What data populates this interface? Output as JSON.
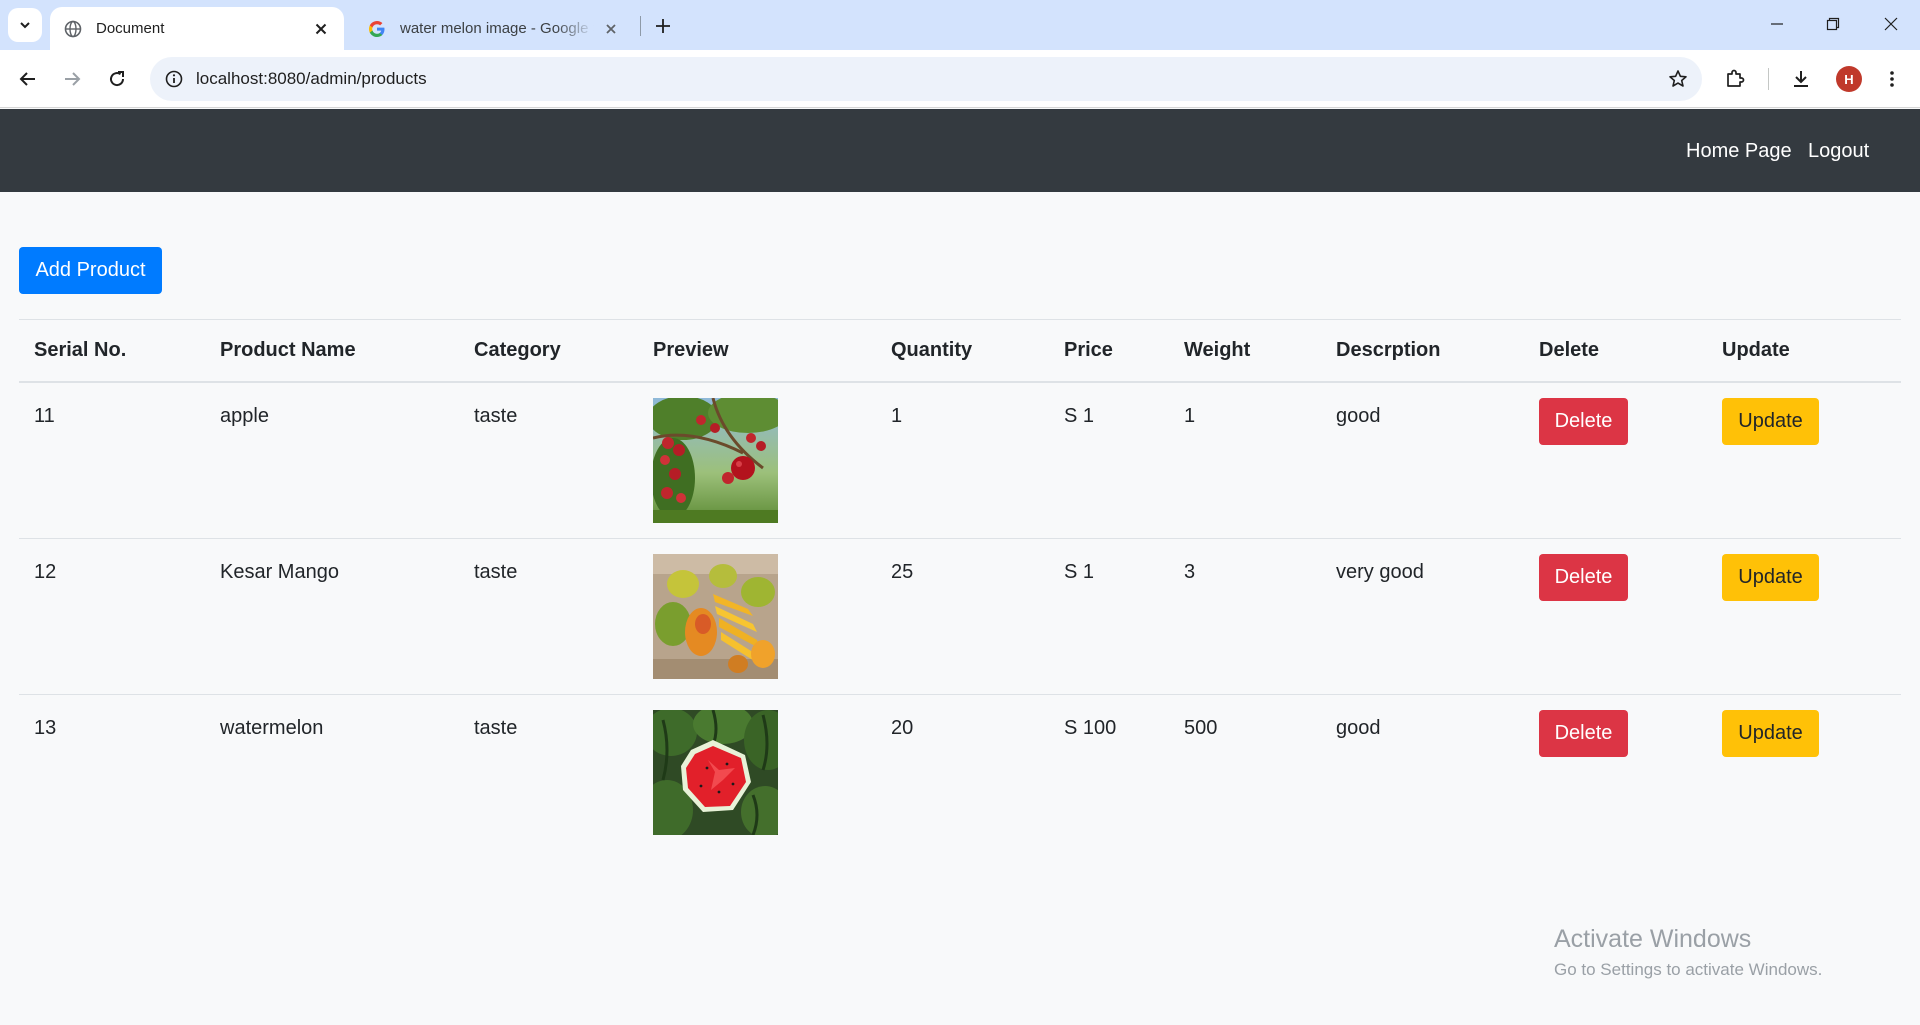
{
  "browser": {
    "tabs": [
      {
        "title": "Document",
        "active": true,
        "icon": "globe-icon"
      },
      {
        "title": "water melon image - Google Search",
        "active": false,
        "icon": "google-icon"
      }
    ],
    "url": "localhost:8080/admin/products",
    "profile_initial": "H",
    "profile_color": "#c0392b"
  },
  "navbar": {
    "links": [
      "Home Page",
      "Logout"
    ],
    "background": "#343a40"
  },
  "page": {
    "add_button": "Add Product"
  },
  "table": {
    "headers": [
      "Serial No.",
      "Product Name",
      "Category",
      "Preview",
      "Quantity",
      "Price",
      "Weight",
      "Descrption",
      "Delete",
      "Update"
    ],
    "rows": [
      {
        "serial": "11",
        "name": "apple",
        "category": "taste",
        "image": "apple-tree-image",
        "quantity": "1",
        "price": "S 1",
        "weight": "1",
        "description": "good",
        "delete": "Delete",
        "update": "Update"
      },
      {
        "serial": "12",
        "name": "Kesar Mango",
        "category": "taste",
        "image": "mango-image",
        "quantity": "25",
        "price": "S 1",
        "weight": "3",
        "description": "very good",
        "delete": "Delete",
        "update": "Update"
      },
      {
        "serial": "13",
        "name": "watermelon",
        "category": "taste",
        "image": "watermelon-image",
        "quantity": "20",
        "price": "S 100",
        "weight": "500",
        "description": "good",
        "delete": "Delete",
        "update": "Update"
      }
    ]
  },
  "colors": {
    "primary": "#007bff",
    "danger": "#dc3545",
    "warning": "#ffc107"
  },
  "watermark": {
    "line1": "Activate Windows",
    "line2": "Go to Settings to activate Windows."
  }
}
